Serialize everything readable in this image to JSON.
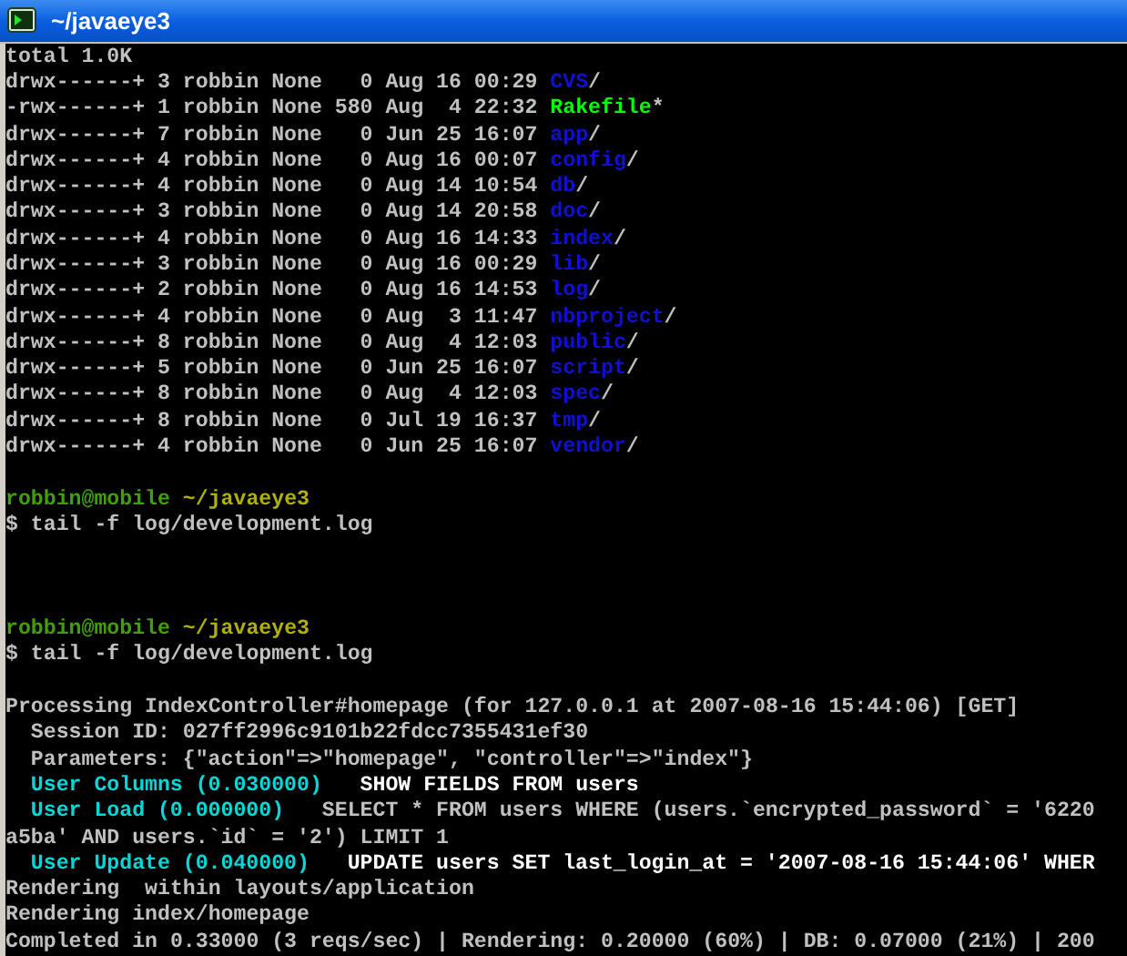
{
  "window": {
    "title": "~/javaeye3"
  },
  "lines": [
    {
      "kind": "text",
      "indented": false,
      "segments": [
        {
          "kind": "plain",
          "text": "total 1.0K"
        }
      ]
    },
    {
      "kind": "text",
      "indented": false,
      "segments": [
        {
          "kind": "plain",
          "text": "drwx------+ 3 robbin None   0 Aug 16 00:29 "
        },
        {
          "kind": "dir",
          "text": "CVS"
        },
        {
          "kind": "suffix",
          "text": "/"
        }
      ]
    },
    {
      "kind": "text",
      "indented": false,
      "segments": [
        {
          "kind": "plain",
          "text": "-rwx------+ 1 robbin None 580 Aug  4 22:32 "
        },
        {
          "kind": "exec",
          "text": "Rakefile"
        },
        {
          "kind": "suffix",
          "text": "*"
        }
      ]
    },
    {
      "kind": "text",
      "indented": false,
      "segments": [
        {
          "kind": "plain",
          "text": "drwx------+ 7 robbin None   0 Jun 25 16:07 "
        },
        {
          "kind": "dir",
          "text": "app"
        },
        {
          "kind": "suffix",
          "text": "/"
        }
      ]
    },
    {
      "kind": "text",
      "indented": false,
      "segments": [
        {
          "kind": "plain",
          "text": "drwx------+ 4 robbin None   0 Aug 16 00:07 "
        },
        {
          "kind": "dir",
          "text": "config"
        },
        {
          "kind": "suffix",
          "text": "/"
        }
      ]
    },
    {
      "kind": "text",
      "indented": false,
      "segments": [
        {
          "kind": "plain",
          "text": "drwx------+ 4 robbin None   0 Aug 14 10:54 "
        },
        {
          "kind": "dir",
          "text": "db"
        },
        {
          "kind": "suffix",
          "text": "/"
        }
      ]
    },
    {
      "kind": "text",
      "indented": false,
      "segments": [
        {
          "kind": "plain",
          "text": "drwx------+ 3 robbin None   0 Aug 14 20:58 "
        },
        {
          "kind": "dir",
          "text": "doc"
        },
        {
          "kind": "suffix",
          "text": "/"
        }
      ]
    },
    {
      "kind": "text",
      "indented": false,
      "segments": [
        {
          "kind": "plain",
          "text": "drwx------+ 4 robbin None   0 Aug 16 14:33 "
        },
        {
          "kind": "dir",
          "text": "index"
        },
        {
          "kind": "suffix",
          "text": "/"
        }
      ]
    },
    {
      "kind": "text",
      "indented": false,
      "segments": [
        {
          "kind": "plain",
          "text": "drwx------+ 3 robbin None   0 Aug 16 00:29 "
        },
        {
          "kind": "dir",
          "text": "lib"
        },
        {
          "kind": "suffix",
          "text": "/"
        }
      ]
    },
    {
      "kind": "text",
      "indented": false,
      "segments": [
        {
          "kind": "plain",
          "text": "drwx------+ 2 robbin None   0 Aug 16 14:53 "
        },
        {
          "kind": "dir",
          "text": "log"
        },
        {
          "kind": "suffix",
          "text": "/"
        }
      ]
    },
    {
      "kind": "text",
      "indented": false,
      "segments": [
        {
          "kind": "plain",
          "text": "drwx------+ 4 robbin None   0 Aug  3 11:47 "
        },
        {
          "kind": "dir",
          "text": "nbproject"
        },
        {
          "kind": "suffix",
          "text": "/"
        }
      ]
    },
    {
      "kind": "text",
      "indented": false,
      "segments": [
        {
          "kind": "plain",
          "text": "drwx------+ 8 robbin None   0 Aug  4 12:03 "
        },
        {
          "kind": "dir",
          "text": "public"
        },
        {
          "kind": "suffix",
          "text": "/"
        }
      ]
    },
    {
      "kind": "text",
      "indented": false,
      "segments": [
        {
          "kind": "plain",
          "text": "drwx------+ 5 robbin None   0 Jun 25 16:07 "
        },
        {
          "kind": "dir",
          "text": "script"
        },
        {
          "kind": "suffix",
          "text": "/"
        }
      ]
    },
    {
      "kind": "text",
      "indented": false,
      "segments": [
        {
          "kind": "plain",
          "text": "drwx------+ 8 robbin None   0 Aug  4 12:03 "
        },
        {
          "kind": "dir",
          "text": "spec"
        },
        {
          "kind": "suffix",
          "text": "/"
        }
      ]
    },
    {
      "kind": "text",
      "indented": false,
      "segments": [
        {
          "kind": "plain",
          "text": "drwx------+ 8 robbin None   0 Jul 19 16:37 "
        },
        {
          "kind": "dir",
          "text": "tmp"
        },
        {
          "kind": "suffix",
          "text": "/"
        }
      ]
    },
    {
      "kind": "text",
      "indented": false,
      "segments": [
        {
          "kind": "plain",
          "text": "drwx------+ 4 robbin None   0 Jun 25 16:07 "
        },
        {
          "kind": "dir",
          "text": "vendor"
        },
        {
          "kind": "suffix",
          "text": "/"
        }
      ]
    },
    {
      "kind": "blank"
    },
    {
      "kind": "text",
      "indented": false,
      "segments": [
        {
          "kind": "user",
          "text": "robbin@mobile"
        },
        {
          "kind": "path",
          "text": "~/javaeye3"
        }
      ]
    },
    {
      "kind": "text",
      "indented": false,
      "segments": [
        {
          "kind": "plain",
          "text": "$ tail -f log/development.log"
        }
      ]
    },
    {
      "kind": "blank"
    },
    {
      "kind": "blank"
    },
    {
      "kind": "blank"
    },
    {
      "kind": "text",
      "indented": false,
      "segments": [
        {
          "kind": "user",
          "text": "robbin@mobile"
        },
        {
          "kind": "path",
          "text": "~/javaeye3"
        }
      ]
    },
    {
      "kind": "text",
      "indented": false,
      "segments": [
        {
          "kind": "plain",
          "text": "$ tail -f log/development.log"
        }
      ]
    },
    {
      "kind": "blank"
    },
    {
      "kind": "text",
      "indented": false,
      "segments": [
        {
          "kind": "plain",
          "text": "Processing IndexController#homepage (for 127.0.0.1 at 2007-08-16 15:44:06) [GET]"
        }
      ]
    },
    {
      "kind": "text",
      "indented": true,
      "segments": [
        {
          "kind": "plain",
          "text": "Session ID: 027ff2996c9101b22fdcc7355431ef30"
        }
      ]
    },
    {
      "kind": "text",
      "indented": true,
      "segments": [
        {
          "kind": "plain",
          "text": "Parameters: {\"action\"=>\"homepage\", \"controller\"=>\"index\"}"
        }
      ]
    },
    {
      "kind": "text",
      "indented": true,
      "segments": [
        {
          "kind": "label",
          "text": "User Columns (0.030000)"
        },
        {
          "kind": "sql",
          "text": "SHOW FIELDS FROM users"
        }
      ]
    },
    {
      "kind": "text",
      "indented": true,
      "segments": [
        {
          "kind": "label",
          "text": "User Load (0.000000)"
        },
        {
          "kind": "plain_sql",
          "text": "SELECT * FROM users WHERE (users.`encrypted_password` = '6220"
        }
      ]
    },
    {
      "kind": "text",
      "indented": false,
      "segments": [
        {
          "kind": "plain",
          "text": "a5ba' AND users.`id` = '2') LIMIT 1"
        }
      ]
    },
    {
      "kind": "text",
      "indented": true,
      "segments": [
        {
          "kind": "label",
          "text": "User Update (0.040000)"
        },
        {
          "kind": "sql",
          "text": "UPDATE users SET last_login_at = '2007-08-16 15:44:06' WHER"
        }
      ]
    },
    {
      "kind": "text",
      "indented": false,
      "segments": [
        {
          "kind": "plain",
          "text": "Rendering  within layouts/application"
        }
      ]
    },
    {
      "kind": "text",
      "indented": false,
      "segments": [
        {
          "kind": "plain",
          "text": "Rendering index/homepage"
        }
      ]
    },
    {
      "kind": "text",
      "indented": false,
      "segments": [
        {
          "kind": "plain",
          "text": "Completed in 0.33000 (3 reqs/sec) | Rendering: 0.20000 (60%) | DB: 0.07000 (21%) | 200"
        }
      ]
    }
  ]
}
